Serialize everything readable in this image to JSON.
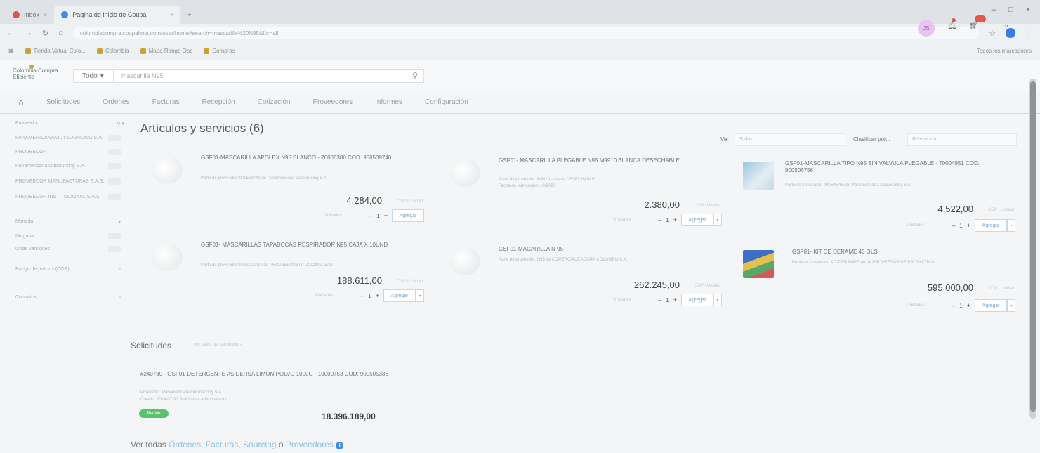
{
  "browser": {
    "tabs": [
      {
        "label": "Inbox",
        "active": false
      },
      {
        "label": "Página de inicio de Coupa",
        "active": true
      }
    ],
    "url": "colombiacompra.coupahost.com/user/home#search=mascarilla%20N95&for=all",
    "bookmarks": [
      "Tienda Virtual Colo...",
      "Colombia",
      "Mapa Rango Ops",
      "Compras"
    ],
    "bookmarks_right": "Todos los marcadores"
  },
  "header": {
    "logo": "Colombia Compra Eficiente",
    "scope": "Todo",
    "search_value": "mascarilla N95",
    "avatar_initials": "JS"
  },
  "nav": {
    "items": [
      "Solicitudes",
      "Órdenes",
      "Facturas",
      "Recepción",
      "Cotización",
      "Proveedores",
      "Informes",
      "Configuración"
    ]
  },
  "sidebar": {
    "head": "Proveedor",
    "suppliers": [
      "PANAMERICANA OUTSOURCING S.A.",
      "PROVEEDOR",
      "Panamericana Outsourcing S.A.",
      "PROVEEDOR MANUFACTURAS S.A.S.",
      "PROVEEDOR INSTITUCIONAL S.A.S."
    ],
    "section2": "Moneda",
    "options2": [
      "Ninguna",
      "Otras versiones"
    ],
    "range": "Rango de precios (COP)",
    "section4": "Contratos"
  },
  "main": {
    "title": "Artículos y servicios (6)",
    "ver_label": "Ver",
    "ver_value": "Todos",
    "sort_label": "Clasificar por...",
    "sort_value": "Relevancia",
    "add_label": "Agregar",
    "qty": "1",
    "uom_label": "Unidades",
    "unit_suffix": "COP / Unidad",
    "items": [
      {
        "name": "GSF01-MASCARILLA APOLEX N95 BLANCO - 70005380 cod. 900509740",
        "sub1": "Parte de proveedor: 900509740 de Panamericana Outsourcing S.A.",
        "sub2": "",
        "price": "4.284,00"
      },
      {
        "name": "gsf01- MASCARILLA PLEGABLE N95 M9910 BLANCA DESECHABLE",
        "sub1": "Parte de proveedor: M9910 - marca DESECHABLE",
        "sub2": "Fecha de fabricación: 10/2023",
        "price": "2.380,00"
      },
      {
        "name": "GSF01-MASCARILLA TIPO N95 SIN VALVULA PLEGABLE - 70004951 cod: 900506756",
        "sub1": "Parte de proveedor: 900506756 de Panamericana Outsourcing S.A.",
        "sub2": "",
        "price": "4.522,00"
      },
      {
        "name": "GSF01- MASCARILLAS TAPABOCAS RESPIRADOR N95 CAJA X 10UND",
        "sub1": "Parte de proveedor: N95CAJA10 de PROVEER INSTITUCIONAL SAS",
        "sub2": "",
        "price": "188.611,00"
      },
      {
        "name": "GSF01-MACARILLA N 95",
        "sub1": "Parte de proveedor: N95 de COMERCIALIZADORA COLOMBIA S.A.",
        "sub2": "",
        "price": "262.245,00"
      },
      {
        "name": "GSF01- KIT DE DERAME 40 GLS",
        "sub1": "Parte de proveedor: KIT-DERRAME-40 de PROVEEDOR DE PRODUCTOS",
        "sub2": "",
        "price": "595.000,00"
      }
    ]
  },
  "requisitions": {
    "title": "Solicitudes",
    "link": "Ver todas las solicitudes »",
    "item": {
      "name": "#240730 - GSF01-DETERGENTE AS DERSA LIMÓN POLVO 1000G - 10000753 cod: 900505386",
      "supplier": "Proveedor: Panamericana Outsourcing S.A.",
      "meta": "Creado: 2024-07-30   Solicitante: Administrador",
      "status": "Pedido",
      "amount": "18.396.189,00"
    }
  },
  "footer": {
    "prefix": "Ver todas",
    "link1": "Órdenes,",
    "link2": "Facturas,",
    "link3": "Sourcing",
    "conj": "o",
    "link4": "Proveedores"
  }
}
